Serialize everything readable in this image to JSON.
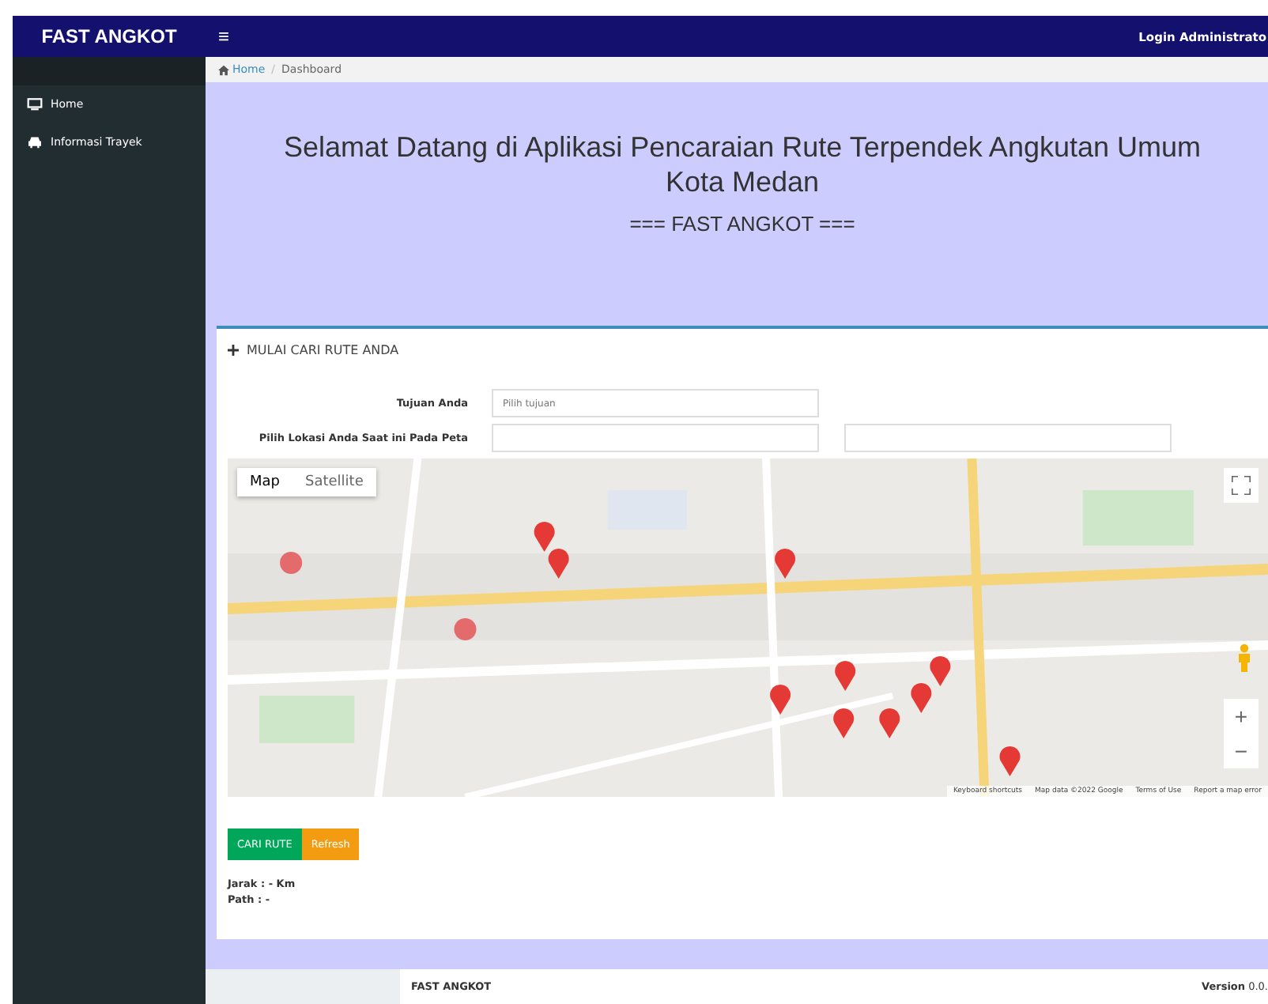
{
  "brand": "FAST ANGKOT",
  "topbar": {
    "menu_icon": "≡",
    "user": "Login Administrato"
  },
  "sidebar": {
    "items": [
      {
        "label": "Home"
      },
      {
        "label": "Informasi Trayek"
      }
    ]
  },
  "breadcrumb": {
    "items": [
      "Home",
      "Dashboard"
    ],
    "separator": "/"
  },
  "hero": {
    "title": "Selamat Datang di Aplikasi Pencaraian Rute Terpendek Angkutan Umum Kota Medan",
    "subtitle": "=== FAST ANGKOT ==="
  },
  "panel": {
    "title": "MULAI CARI RUTE ANDA",
    "fields": [
      {
        "label": "Tujuan Anda",
        "kind": "single",
        "placeholder": "Pilih tujuan"
      },
      {
        "label": "Pilih Lokasi Anda Saat ini Pada Peta",
        "kind": "double"
      }
    ],
    "map": {
      "kind": "picture",
      "types": [
        {
          "label": "Map",
          "selected": true
        },
        {
          "label": "Satellite",
          "selected": false
        }
      ],
      "zoom": [
        "+",
        "−"
      ],
      "attribution": [
        "Keyboard shortcuts",
        "Map data ©2022 Google",
        "Terms of Use",
        "Report a map error"
      ]
    },
    "buttons": [
      {
        "label": "CARI RUTE",
        "kind": "primary"
      },
      {
        "label": "Refresh",
        "kind": "warning"
      }
    ],
    "results": [
      "Jarak : - Km",
      "Path : -"
    ]
  },
  "footer": {
    "brand": "FAST ANGKOT",
    "version_label": "Version",
    "version": "0.0."
  }
}
